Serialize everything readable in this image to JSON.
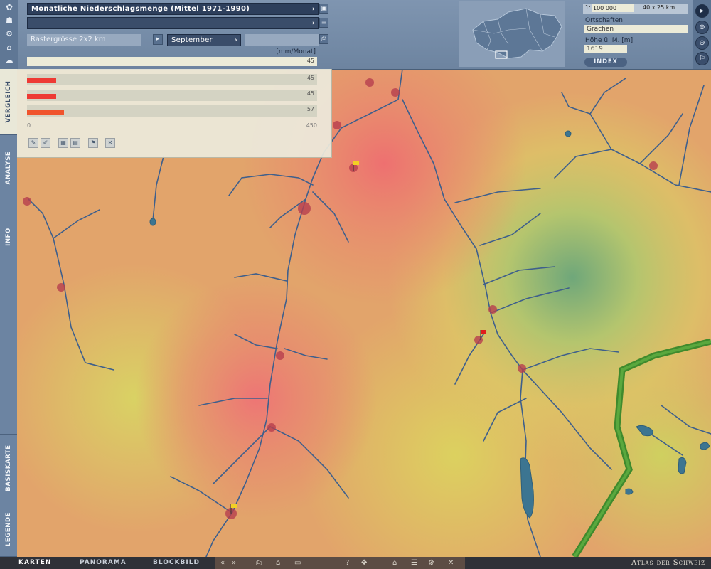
{
  "header": {
    "map_title": "Monatliche Niederschlagsmenge (Mittel 1971-1990)",
    "grid_size": "Rastergrösse 2x2 km",
    "month": "September",
    "unit": "[mm/Monat]",
    "current_value": "45"
  },
  "scale_panel": {
    "scale_prefix": "1:",
    "scale": "100 000",
    "extent": "40 x 25 km",
    "places_label": "Ortschaften",
    "place_value": "Grächen",
    "altitude_label": "Höhe ü. M. [m]",
    "altitude_value": "1619",
    "index_button": "INDEX"
  },
  "left_tabs": [
    "VERGLEICH",
    "ANALYSE",
    "INFO",
    "BASISKARTE",
    "LEGENDE"
  ],
  "comparison": {
    "bars": [
      {
        "value": 45,
        "label": "45",
        "color": "#ee3a34"
      },
      {
        "value": 45,
        "label": "45",
        "color": "#ee3a34"
      },
      {
        "value": 57,
        "label": "57",
        "color": "#f0542d"
      }
    ],
    "axis_min": "0",
    "axis_max": "450",
    "tools": [
      "pin-tool-icon",
      "edit-tool-icon",
      "grid-icon",
      "grid-alt-icon",
      "flag-icon",
      "delete-icon"
    ]
  },
  "bottom_tabs": [
    "KARTEN",
    "PANORAMA",
    "BLOCKBILD"
  ],
  "bottom_icons": [
    "«",
    "»",
    "⎙",
    "⌂",
    "▭",
    "?",
    "✥",
    "⌂",
    "☰",
    "⚙",
    "✕"
  ],
  "brand": "Atlas der Schweiz",
  "map": {
    "flags": [
      {
        "color": "#f2d023"
      },
      {
        "color": "#e01c1c"
      },
      {
        "color": "#f2d023"
      }
    ],
    "border_color": "#3f8a2d"
  }
}
